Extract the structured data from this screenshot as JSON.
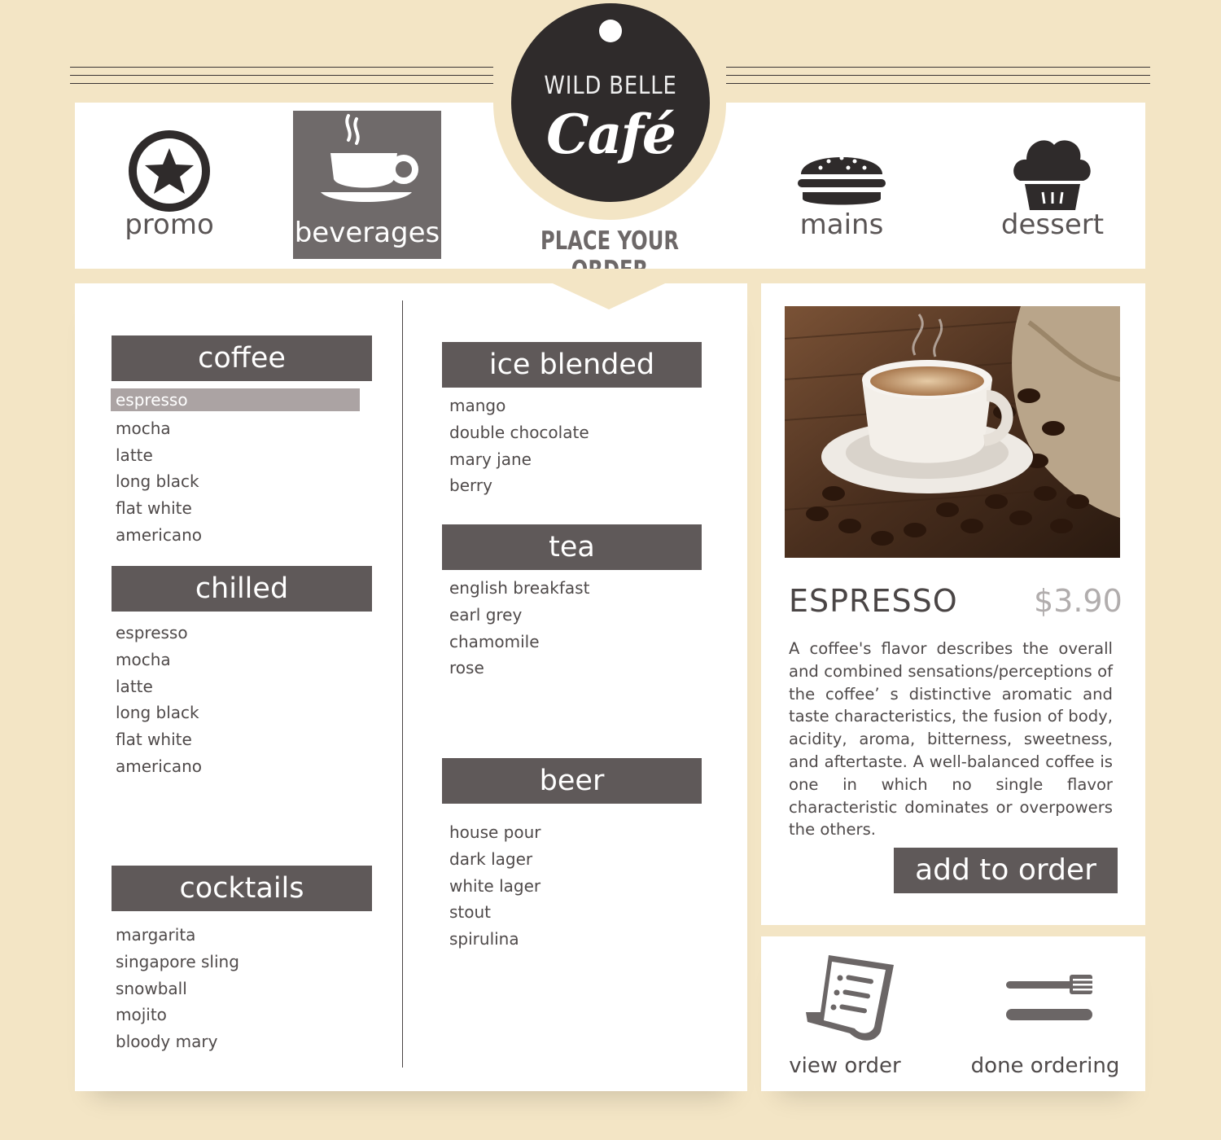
{
  "brand": {
    "name_top": "WILD BELLE",
    "name_script": "Café",
    "tagline": "PLACE YOUR ORDER"
  },
  "nav": {
    "items": [
      {
        "label": "promo",
        "icon": "star-badge-icon"
      },
      {
        "label": "beverages",
        "icon": "coffee-cup-icon",
        "active": true
      },
      {
        "label": "mains",
        "icon": "burger-icon"
      },
      {
        "label": "dessert",
        "icon": "cupcake-icon"
      }
    ]
  },
  "menu": {
    "coffee": {
      "title": "coffee",
      "items": [
        "espresso",
        "mocha",
        "latte",
        "long black",
        "flat white",
        "americano"
      ],
      "selected": "espresso"
    },
    "chilled": {
      "title": "chilled",
      "items": [
        "espresso",
        "mocha",
        "latte",
        "long black",
        "flat white",
        "americano"
      ]
    },
    "cocktails": {
      "title": "cocktails",
      "items": [
        "margarita",
        "singapore sling",
        "snowball",
        "mojito",
        "bloody mary"
      ]
    },
    "ice_blended": {
      "title": "ice blended",
      "items": [
        "mango",
        "double chocolate",
        "mary jane",
        "berry"
      ]
    },
    "tea": {
      "title": "tea",
      "items": [
        "english breakfast",
        "earl grey",
        "chamomile",
        "rose"
      ]
    },
    "beer": {
      "title": "beer",
      "items": [
        "house pour",
        "dark lager",
        "white lager",
        "stout",
        "spirulina"
      ]
    }
  },
  "detail": {
    "name": "ESPRESSO",
    "price": "$3.90",
    "description": "A coffee's flavor describes the overall and combined sensations/perceptions of the coffee’ s distinctive aromatic and taste characteristics, the fusion of body, acidity, aroma, bitterness, sweetness, and aftertaste. A well-balanced coffee is one in which no single flavor characteristic dominates or overpowers the others.",
    "add_button": "add to order"
  },
  "actions": {
    "view_order": "view order",
    "done_ordering": "done ordering"
  },
  "colors": {
    "background": "#f3e5c5",
    "header_bar": "#5f5959",
    "active_nav": "#6f6a6a",
    "badge": "#2f2b2b",
    "selected_item": "#aba3a3"
  }
}
